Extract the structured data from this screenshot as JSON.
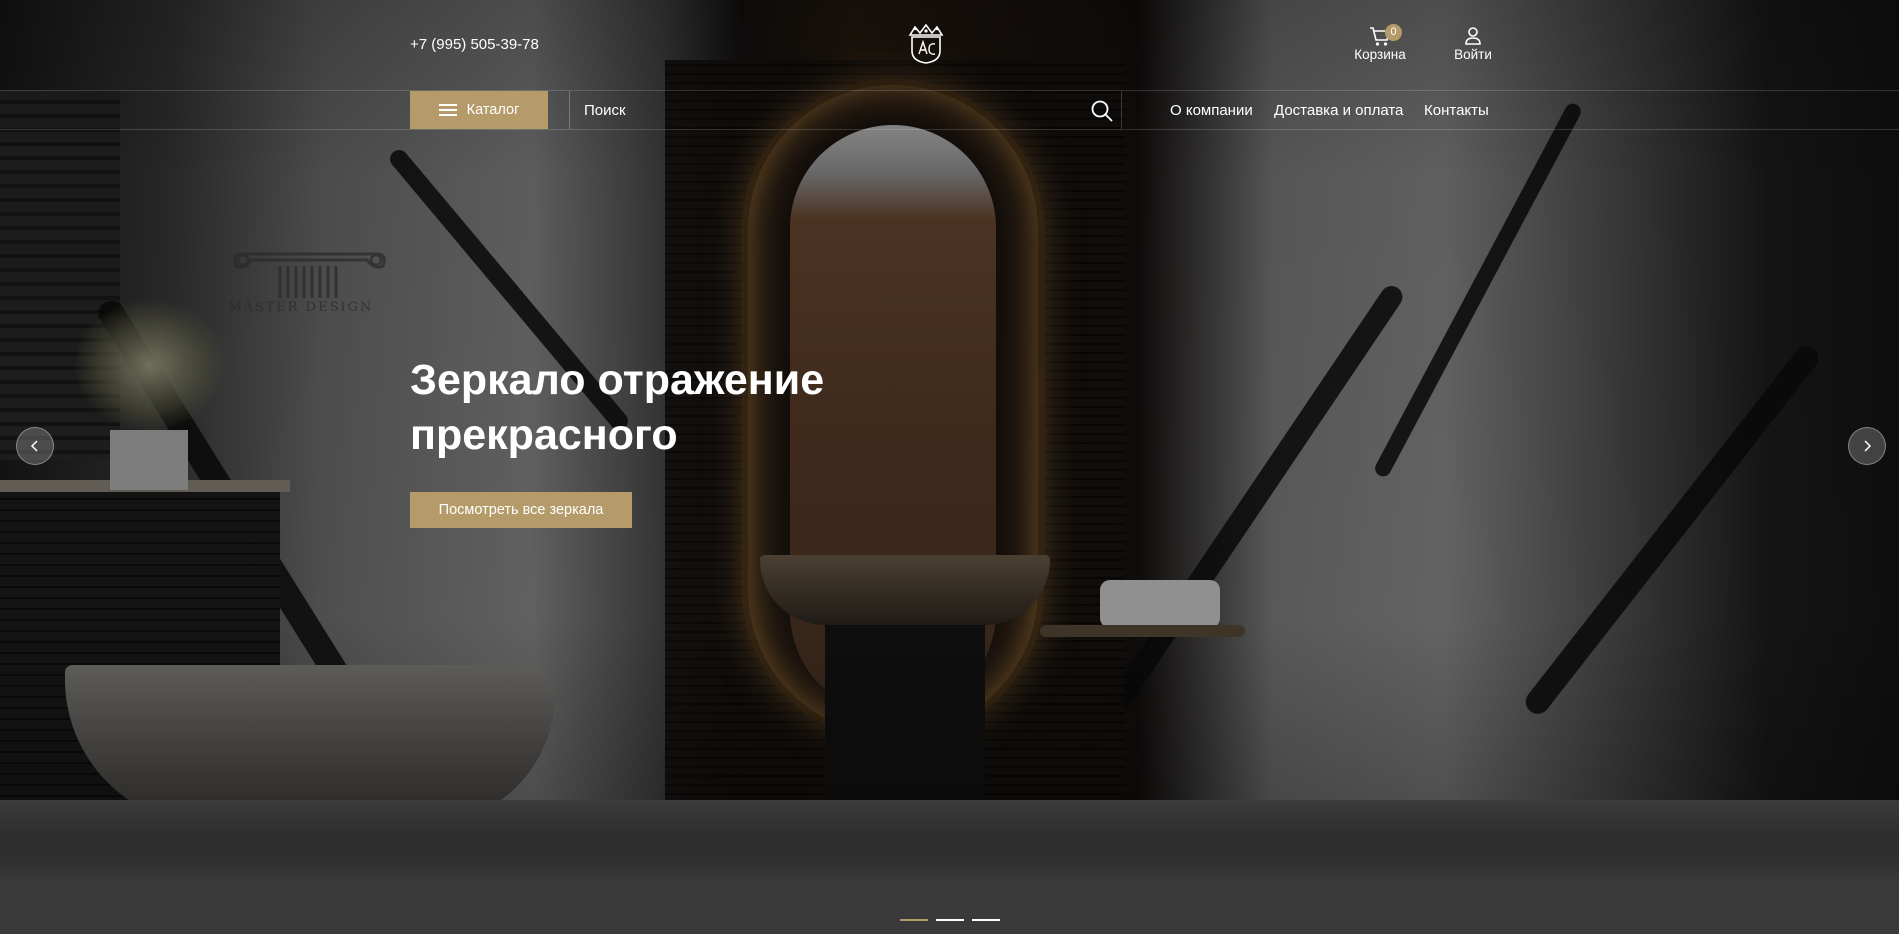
{
  "header": {
    "phone": "+7 (995) 505-39-78",
    "cart": {
      "label": "Корзина",
      "count": "0",
      "icon": "cart-icon"
    },
    "login": {
      "label": "Войти",
      "icon": "user-icon"
    },
    "logo_icon": "crown-emblem-icon"
  },
  "navbar": {
    "catalog_label": "Каталог",
    "search_placeholder": "Поиск",
    "search_icon": "search-icon",
    "links": [
      "О компании",
      "Доставка и оплата",
      "Контакты"
    ]
  },
  "hero": {
    "title_line1": "Зеркало отражение",
    "title_line2": "прекрасного",
    "cta_label": "Посмотреть все зеркала",
    "watermark": "MASTER DESIGN"
  },
  "carousel": {
    "slides": 3,
    "active_slide": 1
  },
  "colors": {
    "accent": "#b59b69",
    "text": "#ffffff",
    "page_bg": "#3a3a3a"
  }
}
